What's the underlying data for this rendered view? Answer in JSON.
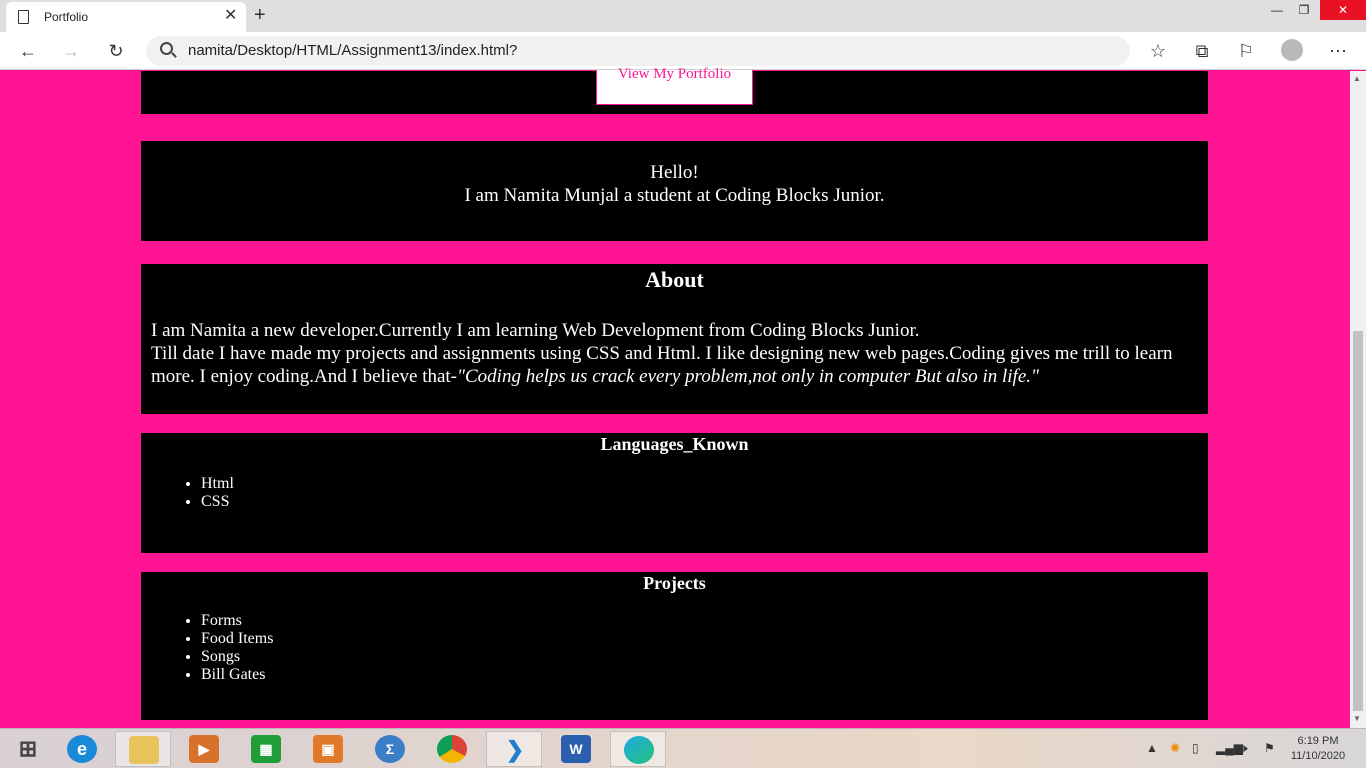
{
  "browser": {
    "tab_title": "Portfolio",
    "url": "namita/Desktop/HTML/Assignment13/index.html?"
  },
  "page": {
    "portfolio_button": "View My Portfolio",
    "hello_line1": "Hello!",
    "hello_line2": "I am Namita Munjal a student at Coding Blocks Junior.",
    "about": {
      "heading": "About",
      "line1": "I am Namita a new developer.Currently I am learning Web Development from Coding Blocks Junior.",
      "line2": "Till date I have made my projects and assignments using CSS and Html. I like designing new web pages.Coding gives me trill to learn more. I enjoy coding.And I believe that-",
      "quote": "\"Coding helps us crack every problem,not only in computer But also in life.\""
    },
    "languages": {
      "heading": "Languages_Known",
      "items": [
        "Html",
        "CSS"
      ]
    },
    "projects": {
      "heading": "Projects",
      "items": [
        "Forms",
        "Food Items",
        "Songs",
        "Bill Gates"
      ]
    }
  },
  "taskbar": {
    "time": "6:19 PM",
    "date": "11/10/2020"
  },
  "colors": {
    "page_background": "#ff1493",
    "card_background": "#000000"
  }
}
